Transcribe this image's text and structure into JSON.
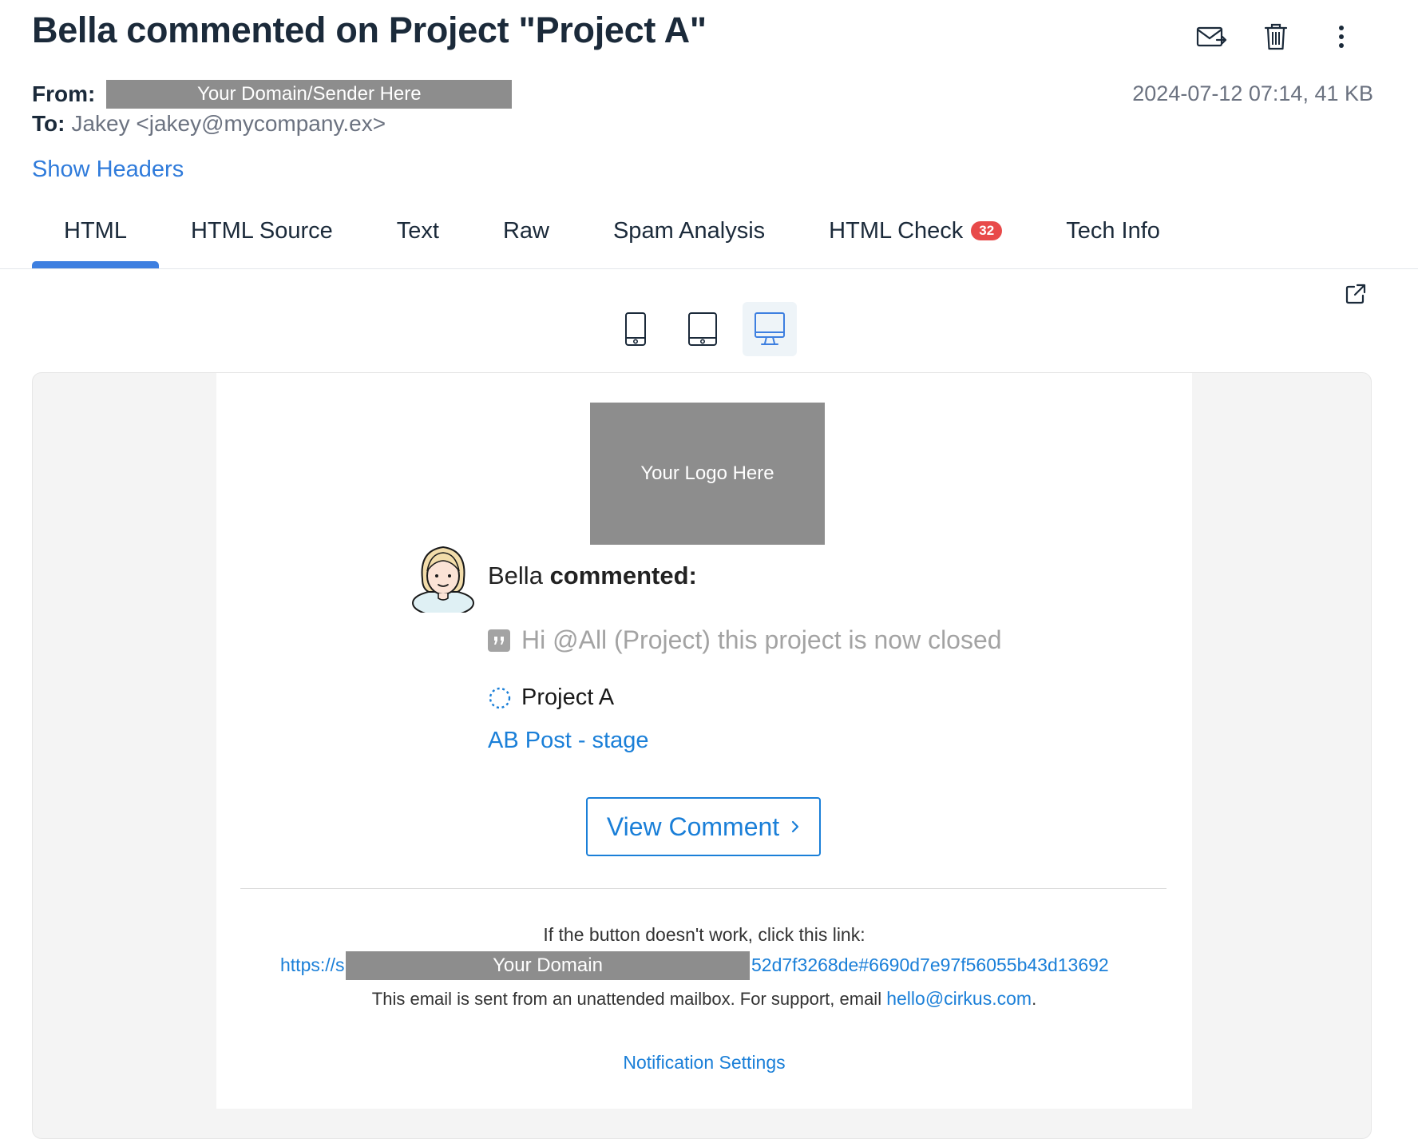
{
  "email": {
    "subject": "Bella commented on Project \"Project A\"",
    "from_label": "From:",
    "from_value": "Your Domain/Sender Here",
    "to_label": "To:",
    "to_value": "Jakey <jakey@mycompany.ex>",
    "date_size": "2024-07-12 07:14, 41 KB",
    "show_headers": "Show Headers"
  },
  "actions": {
    "forward_icon": "envelope-forward-icon",
    "delete_icon": "trash-icon",
    "more_icon": "kebab-menu-icon"
  },
  "tabs": [
    {
      "label": "HTML",
      "active": true
    },
    {
      "label": "HTML Source"
    },
    {
      "label": "Text"
    },
    {
      "label": "Raw"
    },
    {
      "label": "Spam Analysis"
    },
    {
      "label": "HTML Check",
      "badge": "32"
    },
    {
      "label": "Tech Info"
    }
  ],
  "preview": {
    "devices": [
      "phone-icon",
      "tablet-icon",
      "desktop-icon"
    ],
    "active_device": "desktop-icon",
    "external_icon": "external-link-icon"
  },
  "body": {
    "logo_text": "Your Logo Here",
    "commenter": "Bella",
    "commented": "commented:",
    "quote": "Hi @All (Project) this project is now closed",
    "project_name": "Project A",
    "stage_link": "AB Post - stage",
    "view_comment": "View Comment",
    "fallback_text": "If the button doesn't work, click this link:",
    "fallback_link_start": "https://s",
    "fallback_link_redact": "Your Domain",
    "fallback_link_end": "52d7f3268de#6690d7e97f56055b43d13692",
    "unattended_text": "This email is sent from an unattended mailbox. For support, email",
    "support_email": "hello@cirkus.com",
    "unattended_end": ".",
    "notification_settings": "Notification Settings"
  },
  "colors": {
    "accent": "#3d7fe0",
    "link": "#1a7fd8",
    "badge": "#e84a4a",
    "redaction": "#8d8d8d"
  }
}
